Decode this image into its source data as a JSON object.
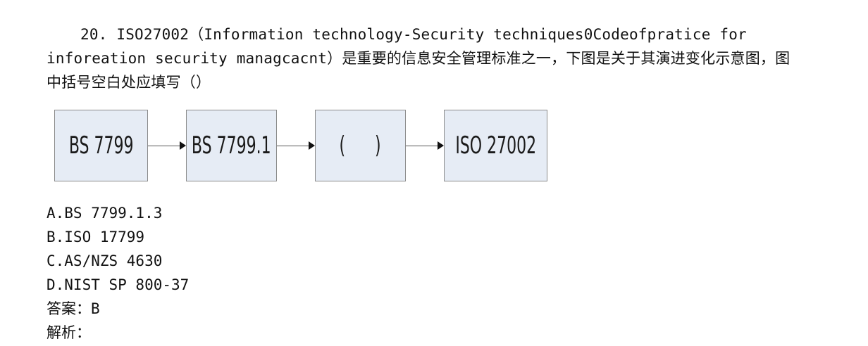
{
  "question": {
    "number": "20.",
    "text": "ISO27002（Information technology-Security techniques0Codeofpratice for inforeation security managcacnt）是重要的信息安全管理标准之一，下图是关于其演进变化示意图，图中括号空白处应填写（）"
  },
  "diagram": {
    "boxes": [
      {
        "label": "BS 7799"
      },
      {
        "label": "BS 7799.1"
      },
      {
        "label": "(      )"
      },
      {
        "label": "ISO 27002"
      }
    ]
  },
  "options": [
    {
      "text": "A.BS 7799.1.3"
    },
    {
      "text": "B.ISO 17799"
    },
    {
      "text": "C.AS/NZS 4630"
    },
    {
      "text": "D.NIST SP 800-37"
    }
  ],
  "answer": {
    "text": "答案：B"
  },
  "analysis": {
    "text": "解析："
  }
}
